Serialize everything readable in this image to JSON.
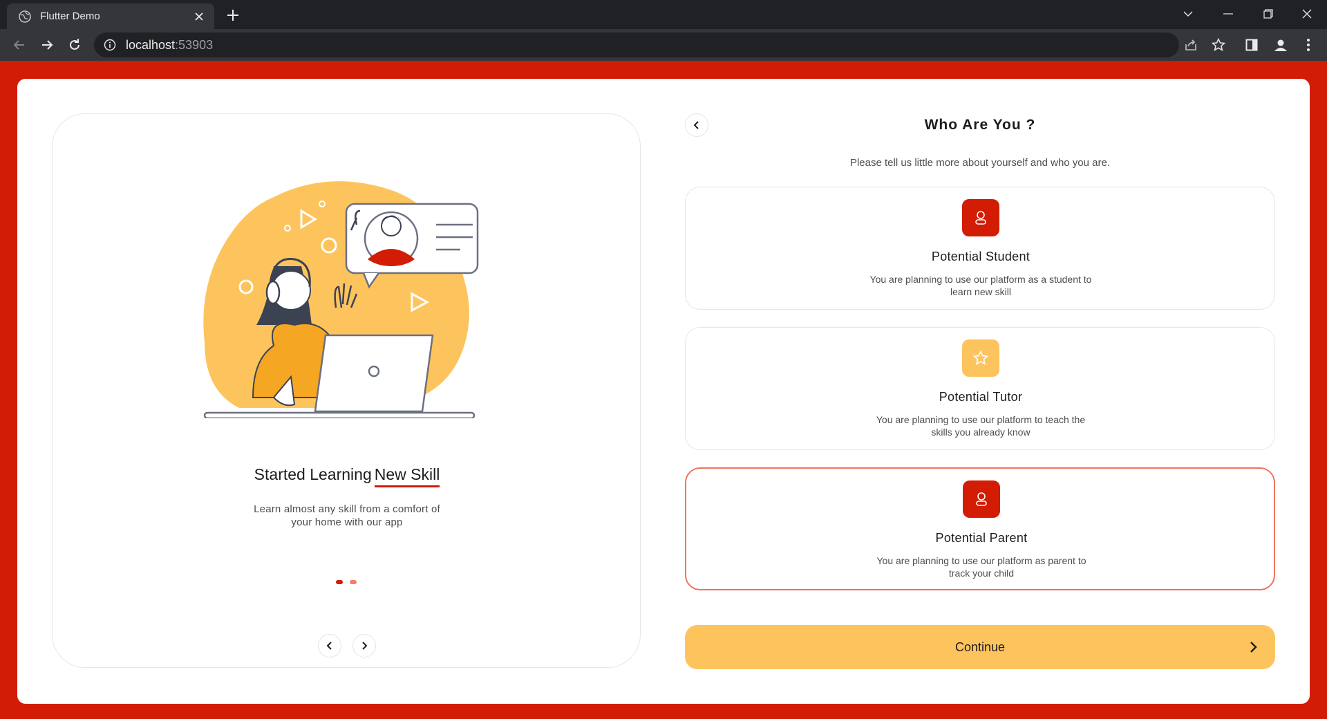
{
  "browser": {
    "tab_title": "Flutter Demo",
    "url_host": "localhost",
    "url_port": ":53903"
  },
  "left": {
    "slide_title_main": "Started Learning",
    "slide_title_accent": "New Skill",
    "slide_desc": "Learn almost any skill from a comfort of your home with our app",
    "slide_index": 1,
    "slide_count": 2
  },
  "right": {
    "title": "Who Are You ?",
    "subtitle": "Please tell us little more about yourself and who you are.",
    "roles": [
      {
        "name": "Potential Student",
        "desc": "You are planning to use our platform as a student to learn new skill",
        "icon": "person-icon",
        "icon_color": "#d21c04",
        "selected": false
      },
      {
        "name": "Potential Tutor",
        "desc": "You are planning to use our platform to teach the skills you already know",
        "icon": "star-icon",
        "icon_color": "#fdc45e",
        "selected": false
      },
      {
        "name": "Potential Parent",
        "desc": "You are planning to use our platform as parent to track your child",
        "icon": "person-icon",
        "icon_color": "#d21c04",
        "selected": true
      }
    ],
    "continue_label": "Continue"
  },
  "colors": {
    "brand_red": "#d21c04",
    "accent_yellow": "#fdc45e",
    "selected_border": "#ee7460"
  }
}
